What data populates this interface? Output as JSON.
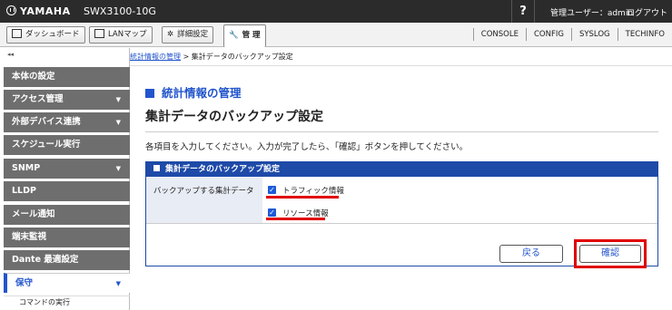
{
  "header": {
    "brand": "YAMAHA",
    "model": "SWX3100-10G",
    "help": "?",
    "user": "管理ユーザー：admin",
    "logout": "ログアウト"
  },
  "nav": {
    "dashboard": "ダッシュボード",
    "lanmap": "LANマップ",
    "advanced": "詳細設定",
    "admin": "管 理",
    "links": [
      "CONSOLE",
      "CONFIG",
      "SYSLOG",
      "TECHINFO"
    ]
  },
  "sidebar": {
    "collapse": "◂◂",
    "items": [
      {
        "label": "本体の設定",
        "arrow": ""
      },
      {
        "label": "アクセス管理",
        "arrow": "▼"
      },
      {
        "label": "外部デバイス連携",
        "arrow": "▼"
      },
      {
        "label": "スケジュール実行",
        "arrow": ""
      },
      {
        "label": "SNMP",
        "arrow": "▼"
      },
      {
        "label": "LLDP",
        "arrow": ""
      },
      {
        "label": "メール通知",
        "arrow": ""
      },
      {
        "label": "端末監視",
        "arrow": ""
      },
      {
        "label": "Dante 最適設定",
        "arrow": ""
      },
      {
        "label": "保守",
        "arrow": "▼"
      }
    ],
    "sub": "コマンドの実行"
  },
  "breadcrumb": {
    "link": "統計情報の管理",
    "sep": " > ",
    "current": "集計データのバックアップ設定"
  },
  "main": {
    "heading": "統計情報の管理",
    "title": "集計データのバックアップ設定",
    "instruction": "各項目を入力してください。入力が完了したら、「確認」ボタンを押してください。",
    "panel_title": "集計データのバックアップ設定",
    "field_label": "バックアップする集計データ",
    "options": [
      {
        "label": "トラフィック情報",
        "checked": true
      },
      {
        "label": "リソース情報",
        "checked": true
      }
    ],
    "back_button": "戻る",
    "confirm_button": "確認"
  },
  "colors": {
    "accent": "#2255cc",
    "panel": "#1e4aa8",
    "highlight": "#e00000"
  }
}
